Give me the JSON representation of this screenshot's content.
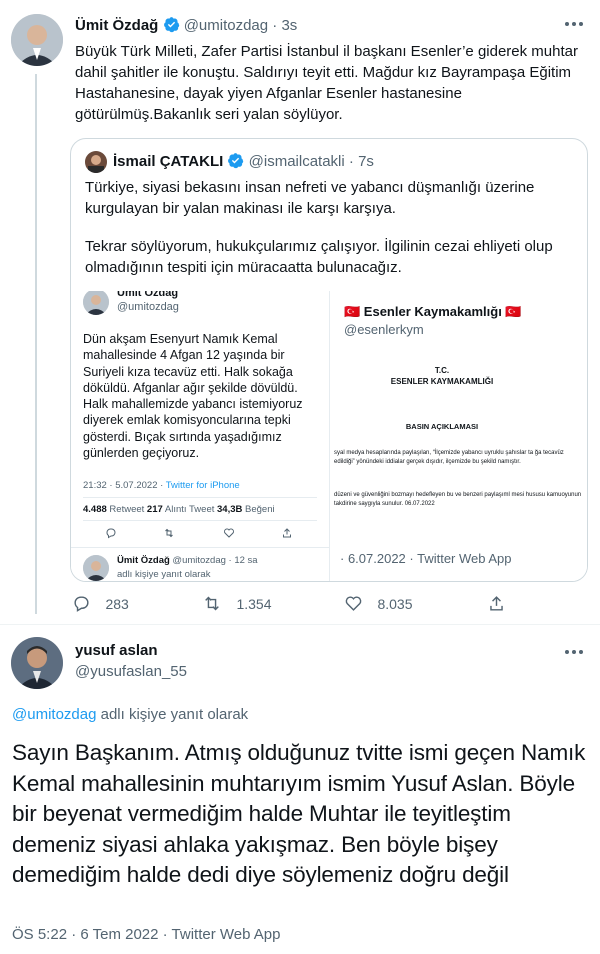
{
  "tweet1": {
    "name": "Ümit Özdağ",
    "handle": "@umitozdag",
    "time": "3s",
    "text": "Büyük Türk Milleti, Zafer Partisi İstanbul il başkanı Esenler’e giderek muhtar dahil şahitler ile konuştu. Saldırıyı teyit etti. Mağdur kız Bayrampaşa Eğitim Hastahanesine, dayak yiyen Afganlar Esenler hastanesine götürülmüş.Bakanlık seri yalan söylüyor.",
    "counts": {
      "replies": "283",
      "retweets": "1.354",
      "likes": "8.035"
    }
  },
  "quoted": {
    "name": "İsmail ÇATAKLI",
    "handle": "@ismailcatakli",
    "time": "7s",
    "para1": "Türkiye, siyasi bekasını insan nefreti ve yabancı düşmanlığı üzerine kurgulayan bir yalan makinası ile karşı karşıya.",
    "para2": "Tekrar söylüyorum, hukukçularımız çalışıyor. İlgilinin cezai ehliyeti olup olmadığının tespiti için müracaatta bulunacağız."
  },
  "screenshot_left": {
    "name_partial": "Ümit Özdağ",
    "handle": "@umitozdag",
    "text": "Dün akşam Esenyurt Namık Kemal mahallesinde 4 Afgan 12 yaşında bir Suriyeli kıza tecavüz etti. Halk sokağa döküldü. Afganlar ağır şekilde dövüldü. Halk mahallemizde yabancı istemiyoruz diyerek emlak komisyoncularına tepki gösterdi. Bıçak sırtında yaşadığımız günlerden geçiyoruz.",
    "meta_time": "21:32 · 5.07.2022 · ",
    "meta_source": "Twitter for iPhone",
    "stats": {
      "retweet_n": "4.488",
      "retweet_l": "Retweet",
      "quote_n": "217",
      "quote_l": "Alıntı Tweet",
      "like_n": "34,3B",
      "like_l": "Beğeni"
    },
    "footer_name": "Ümit Özdağ",
    "footer_handle": "@umitozdag · 12 sa",
    "footer_reply": "adlı kişiye yanıt olarak"
  },
  "screenshot_right": {
    "title": "🇹🇷 Esenler Kaymakamlığı 🇹🇷",
    "handle": "@esenlerkym",
    "doc_line1": "T.C.",
    "doc_line2": "ESENLER KAYMAKAMLIĞI",
    "doc_heading": "BASIN AÇIKLAMASI",
    "doc_p1": "syal medya hesaplarında paylaşılan, “İlçemizde yabancı uyruklu şahıslar ta ğa tecavüz edildiği” yönündeki iddialar gerçek dışıdır, ilçemizde bu şekild namıştır.",
    "doc_p2": "düzeni ve güvenliğini bozmayı hedefleyen bu ve benzeri paylaşıml mesi hususu kamuoyunun takdirine saygıyla sunulur. 06.07.2022",
    "meta": "· 6.07.2022 · Twitter Web App"
  },
  "reply": {
    "name": "yusuf aslan",
    "handle": "@yusufaslan_55",
    "reply_to_handle": "@umitozdag",
    "reply_to_text": " adlı kişiye yanıt olarak",
    "text": "Sayın Başkanım. Atmış olduğunuz tvitte ismi geçen Namık Kemal mahallesinin muhtarıyım ismim Yusuf Aslan. Böyle bir beyenat vermediğim halde Muhtar ile teyitleştim demeniz siyasi ahlaka yakışmaz. Ben böyle bişey demediğim halde dedi diye söylemeniz doğru değil",
    "meta": "ÖS 5:22 · 6 Tem 2022 · Twitter Web App"
  },
  "icons": {
    "verified": "verified-badge-icon",
    "more": "more-dots-icon",
    "reply": "reply-icon",
    "retweet": "retweet-icon",
    "like": "like-icon",
    "share": "share-icon",
    "flag": "turkey-flag-icon"
  },
  "colors": {
    "accent": "#1d9bf0",
    "muted": "#536471",
    "border": "#cfd9de",
    "text": "#0f1419"
  }
}
